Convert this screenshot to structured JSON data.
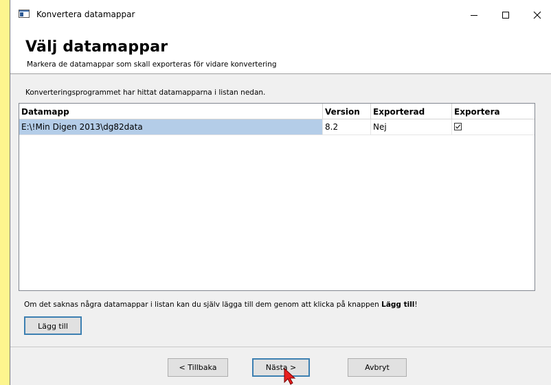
{
  "window": {
    "title": "Konvertera datamappar"
  },
  "header": {
    "title": "Välj datamappar",
    "subtitle": "Markera de datamappar som skall  exporteras för vidare konvertering"
  },
  "info_text": "Konverteringsprogrammet har hittat datamapparna i listan nedan.",
  "table": {
    "columns": [
      "Datamapp",
      "Version",
      "Exporterad",
      "Exportera"
    ],
    "rows": [
      {
        "datamapp": "E:\\!Min Digen 2013\\dg82data",
        "version": "8.2",
        "exporterad": "Nej",
        "exportera": true
      }
    ]
  },
  "hint": {
    "prefix": "Om det saknas några datamappar i listan kan du själv lägga till dem genom att klicka på knappen ",
    "bold": "Lägg till",
    "suffix": "!"
  },
  "buttons": {
    "add": "Lägg till",
    "back": "< Tillbaka",
    "next": "Nästa >",
    "cancel": "Avbryt"
  },
  "colors": {
    "desktop": "#fdf58e",
    "selection": "#b4cde8",
    "focus_border": "#3c7fb1"
  },
  "icons": {
    "app": "window-icon",
    "minimize": "minimize-icon",
    "maximize": "maximize-icon",
    "close": "close-icon",
    "cursor": "mouse-pointer-icon"
  }
}
